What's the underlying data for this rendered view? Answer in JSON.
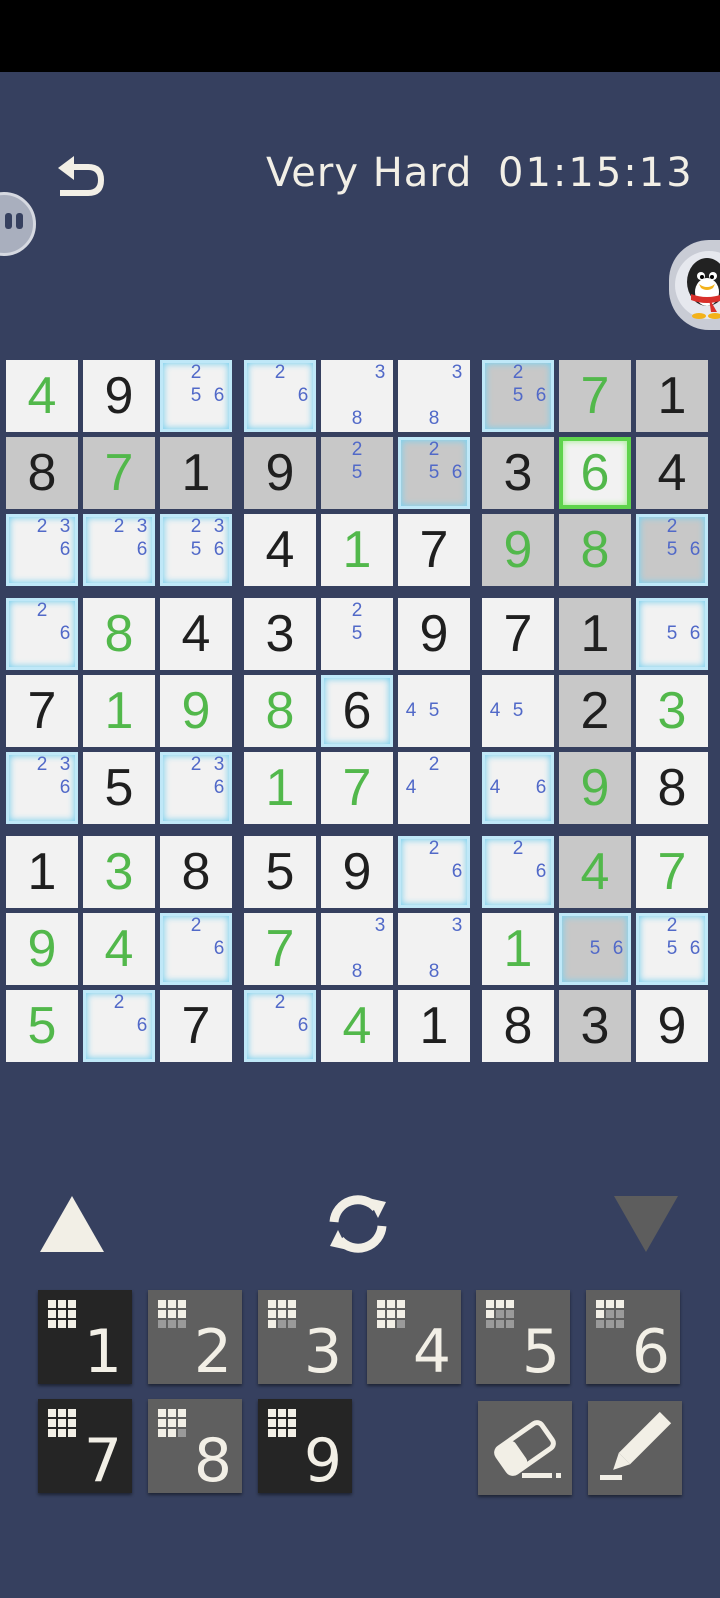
{
  "header": {
    "difficulty": "Very Hard",
    "timer": "01:15:13"
  },
  "colors": {
    "background": "#36405f",
    "given_digit": "#1f1f1f",
    "placed_digit": "#52b84b",
    "pencil_note": "#5169c8",
    "note_highlight": "#7fd2ef",
    "selected_border": "#5fd34d"
  },
  "board": {
    "rows": [
      [
        {
          "digit": "4",
          "style": "placed",
          "bg": "white",
          "notes": [],
          "hl": false
        },
        {
          "digit": "9",
          "style": "given",
          "bg": "white",
          "notes": [],
          "hl": false
        },
        {
          "digit": "",
          "style": "",
          "bg": "white",
          "notes": [
            "2",
            "5",
            "6"
          ],
          "hl": true
        },
        {
          "digit": "",
          "style": "",
          "bg": "white",
          "notes": [
            "2",
            "6"
          ],
          "hl": true
        },
        {
          "digit": "",
          "style": "",
          "bg": "white",
          "notes": [
            "3",
            "8"
          ],
          "hl": false
        },
        {
          "digit": "",
          "style": "",
          "bg": "white",
          "notes": [
            "3",
            "8"
          ],
          "hl": false
        },
        {
          "digit": "",
          "style": "",
          "bg": "grey",
          "notes": [
            "2",
            "5",
            "6"
          ],
          "hl": true
        },
        {
          "digit": "7",
          "style": "placed",
          "bg": "grey",
          "notes": [],
          "hl": false
        },
        {
          "digit": "1",
          "style": "given",
          "bg": "grey",
          "notes": [],
          "hl": false
        }
      ],
      [
        {
          "digit": "8",
          "style": "given",
          "bg": "grey",
          "notes": [],
          "hl": false
        },
        {
          "digit": "7",
          "style": "placed",
          "bg": "grey",
          "notes": [],
          "hl": false
        },
        {
          "digit": "1",
          "style": "given",
          "bg": "grey",
          "notes": [],
          "hl": false
        },
        {
          "digit": "9",
          "style": "given",
          "bg": "grey",
          "notes": [],
          "hl": false
        },
        {
          "digit": "",
          "style": "",
          "bg": "grey",
          "notes": [
            "2",
            "5"
          ],
          "hl": false
        },
        {
          "digit": "",
          "style": "",
          "bg": "grey",
          "notes": [
            "2",
            "5",
            "6"
          ],
          "hl": true
        },
        {
          "digit": "3",
          "style": "given",
          "bg": "grey",
          "notes": [],
          "hl": false
        },
        {
          "digit": "6",
          "style": "placed",
          "bg": "white",
          "notes": [],
          "hl": false,
          "selected": true
        },
        {
          "digit": "4",
          "style": "given",
          "bg": "grey",
          "notes": [],
          "hl": false
        }
      ],
      [
        {
          "digit": "",
          "style": "",
          "bg": "white",
          "notes": [
            "2",
            "3",
            "6"
          ],
          "hl": true
        },
        {
          "digit": "",
          "style": "",
          "bg": "white",
          "notes": [
            "2",
            "3",
            "6"
          ],
          "hl": true
        },
        {
          "digit": "",
          "style": "",
          "bg": "white",
          "notes": [
            "2",
            "3",
            "5",
            "6"
          ],
          "hl": true
        },
        {
          "digit": "4",
          "style": "given",
          "bg": "white",
          "notes": [],
          "hl": false
        },
        {
          "digit": "1",
          "style": "placed",
          "bg": "white",
          "notes": [],
          "hl": false
        },
        {
          "digit": "7",
          "style": "given",
          "bg": "white",
          "notes": [],
          "hl": false
        },
        {
          "digit": "9",
          "style": "placed",
          "bg": "grey",
          "notes": [],
          "hl": false
        },
        {
          "digit": "8",
          "style": "placed",
          "bg": "grey",
          "notes": [],
          "hl": false
        },
        {
          "digit": "",
          "style": "",
          "bg": "grey",
          "notes": [
            "2",
            "5",
            "6"
          ],
          "hl": true
        }
      ],
      [
        {
          "digit": "",
          "style": "",
          "bg": "white",
          "notes": [
            "2",
            "6"
          ],
          "hl": true
        },
        {
          "digit": "8",
          "style": "placed",
          "bg": "white",
          "notes": [],
          "hl": false
        },
        {
          "digit": "4",
          "style": "given",
          "bg": "white",
          "notes": [],
          "hl": false
        },
        {
          "digit": "3",
          "style": "given",
          "bg": "white",
          "notes": [],
          "hl": false
        },
        {
          "digit": "",
          "style": "",
          "bg": "white",
          "notes": [
            "2",
            "5"
          ],
          "hl": false
        },
        {
          "digit": "9",
          "style": "given",
          "bg": "white",
          "notes": [],
          "hl": false
        },
        {
          "digit": "7",
          "style": "given",
          "bg": "white",
          "notes": [],
          "hl": false
        },
        {
          "digit": "1",
          "style": "given",
          "bg": "grey",
          "notes": [],
          "hl": false
        },
        {
          "digit": "",
          "style": "",
          "bg": "white",
          "notes": [
            "5",
            "6"
          ],
          "hl": true
        }
      ],
      [
        {
          "digit": "7",
          "style": "given",
          "bg": "white",
          "notes": [],
          "hl": false
        },
        {
          "digit": "1",
          "style": "placed",
          "bg": "white",
          "notes": [],
          "hl": false
        },
        {
          "digit": "9",
          "style": "placed",
          "bg": "white",
          "notes": [],
          "hl": false
        },
        {
          "digit": "8",
          "style": "placed",
          "bg": "white",
          "notes": [],
          "hl": false
        },
        {
          "digit": "6",
          "style": "given",
          "bg": "white",
          "notes": [],
          "hl": true
        },
        {
          "digit": "",
          "style": "",
          "bg": "white",
          "notes": [
            "4",
            "5"
          ],
          "hl": false
        },
        {
          "digit": "",
          "style": "",
          "bg": "white",
          "notes": [
            "4",
            "5"
          ],
          "hl": false
        },
        {
          "digit": "2",
          "style": "given",
          "bg": "grey",
          "notes": [],
          "hl": false
        },
        {
          "digit": "3",
          "style": "placed",
          "bg": "white",
          "notes": [],
          "hl": false
        }
      ],
      [
        {
          "digit": "",
          "style": "",
          "bg": "white",
          "notes": [
            "2",
            "3",
            "6"
          ],
          "hl": true
        },
        {
          "digit": "5",
          "style": "given",
          "bg": "white",
          "notes": [],
          "hl": false
        },
        {
          "digit": "",
          "style": "",
          "bg": "white",
          "notes": [
            "2",
            "3",
            "6"
          ],
          "hl": true
        },
        {
          "digit": "1",
          "style": "placed",
          "bg": "white",
          "notes": [],
          "hl": false
        },
        {
          "digit": "7",
          "style": "placed",
          "bg": "white",
          "notes": [],
          "hl": false
        },
        {
          "digit": "",
          "style": "",
          "bg": "white",
          "notes": [
            "2",
            "4"
          ],
          "hl": false
        },
        {
          "digit": "",
          "style": "",
          "bg": "white",
          "notes": [
            "4",
            "6"
          ],
          "hl": true
        },
        {
          "digit": "9",
          "style": "placed",
          "bg": "grey",
          "notes": [],
          "hl": false
        },
        {
          "digit": "8",
          "style": "given",
          "bg": "white",
          "notes": [],
          "hl": false
        }
      ],
      [
        {
          "digit": "1",
          "style": "given",
          "bg": "white",
          "notes": [],
          "hl": false
        },
        {
          "digit": "3",
          "style": "placed",
          "bg": "white",
          "notes": [],
          "hl": false
        },
        {
          "digit": "8",
          "style": "given",
          "bg": "white",
          "notes": [],
          "hl": false
        },
        {
          "digit": "5",
          "style": "given",
          "bg": "white",
          "notes": [],
          "hl": false
        },
        {
          "digit": "9",
          "style": "given",
          "bg": "white",
          "notes": [],
          "hl": false
        },
        {
          "digit": "",
          "style": "",
          "bg": "white",
          "notes": [
            "2",
            "6"
          ],
          "hl": true
        },
        {
          "digit": "",
          "style": "",
          "bg": "white",
          "notes": [
            "2",
            "6"
          ],
          "hl": true
        },
        {
          "digit": "4",
          "style": "placed",
          "bg": "grey",
          "notes": [],
          "hl": false
        },
        {
          "digit": "7",
          "style": "placed",
          "bg": "white",
          "notes": [],
          "hl": false
        }
      ],
      [
        {
          "digit": "9",
          "style": "placed",
          "bg": "white",
          "notes": [],
          "hl": false
        },
        {
          "digit": "4",
          "style": "placed",
          "bg": "white",
          "notes": [],
          "hl": false
        },
        {
          "digit": "",
          "style": "",
          "bg": "white",
          "notes": [
            "2",
            "6"
          ],
          "hl": true
        },
        {
          "digit": "7",
          "style": "placed",
          "bg": "white",
          "notes": [],
          "hl": false
        },
        {
          "digit": "",
          "style": "",
          "bg": "white",
          "notes": [
            "3",
            "8"
          ],
          "hl": false
        },
        {
          "digit": "",
          "style": "",
          "bg": "white",
          "notes": [
            "3",
            "8"
          ],
          "hl": false
        },
        {
          "digit": "1",
          "style": "placed",
          "bg": "white",
          "notes": [],
          "hl": false
        },
        {
          "digit": "",
          "style": "",
          "bg": "grey",
          "notes": [
            "5",
            "6"
          ],
          "hl": true
        },
        {
          "digit": "",
          "style": "",
          "bg": "white",
          "notes": [
            "2",
            "5",
            "6"
          ],
          "hl": true
        }
      ],
      [
        {
          "digit": "5",
          "style": "placed",
          "bg": "white",
          "notes": [],
          "hl": false
        },
        {
          "digit": "",
          "style": "",
          "bg": "white",
          "notes": [
            "2",
            "6"
          ],
          "hl": true
        },
        {
          "digit": "7",
          "style": "given",
          "bg": "white",
          "notes": [],
          "hl": false
        },
        {
          "digit": "",
          "style": "",
          "bg": "white",
          "notes": [
            "2",
            "6"
          ],
          "hl": true
        },
        {
          "digit": "4",
          "style": "placed",
          "bg": "white",
          "notes": [],
          "hl": false
        },
        {
          "digit": "1",
          "style": "given",
          "bg": "white",
          "notes": [],
          "hl": false
        },
        {
          "digit": "8",
          "style": "given",
          "bg": "white",
          "notes": [],
          "hl": false
        },
        {
          "digit": "3",
          "style": "given",
          "bg": "grey",
          "notes": [],
          "hl": false
        },
        {
          "digit": "9",
          "style": "given",
          "bg": "white",
          "notes": [],
          "hl": false
        }
      ]
    ]
  },
  "controls": {
    "up_icon": "triangle-up-icon",
    "refresh_icon": "refresh-icon",
    "down_icon": "triangle-down-icon"
  },
  "keypad": [
    {
      "label": "1",
      "style": "dark",
      "progress": [
        1,
        1,
        1,
        1,
        1,
        1,
        1,
        1,
        1
      ]
    },
    {
      "label": "2",
      "style": "mid",
      "progress": [
        1,
        1,
        1,
        1,
        1,
        1,
        0,
        0,
        0
      ]
    },
    {
      "label": "3",
      "style": "mid",
      "progress": [
        1,
        1,
        1,
        1,
        1,
        1,
        1,
        0,
        0
      ]
    },
    {
      "label": "4",
      "style": "mid",
      "progress": [
        1,
        1,
        1,
        1,
        1,
        1,
        1,
        1,
        0
      ]
    },
    {
      "label": "5",
      "style": "mid",
      "progress": [
        1,
        1,
        1,
        1,
        0,
        0,
        0,
        0,
        0
      ]
    },
    {
      "label": "6",
      "style": "mid",
      "progress": [
        1,
        1,
        1,
        1,
        0,
        0,
        0,
        0,
        0
      ]
    },
    {
      "label": "7",
      "style": "dark",
      "progress": [
        1,
        1,
        1,
        1,
        1,
        1,
        1,
        1,
        1
      ]
    },
    {
      "label": "8",
      "style": "mid",
      "progress": [
        1,
        1,
        1,
        1,
        1,
        1,
        1,
        1,
        0
      ]
    },
    {
      "label": "9",
      "style": "dark",
      "progress": [
        1,
        1,
        1,
        1,
        1,
        1,
        1,
        1,
        1
      ]
    }
  ],
  "tools": {
    "eraser_icon": "eraser-icon",
    "pencil_icon": "pencil-icon"
  }
}
